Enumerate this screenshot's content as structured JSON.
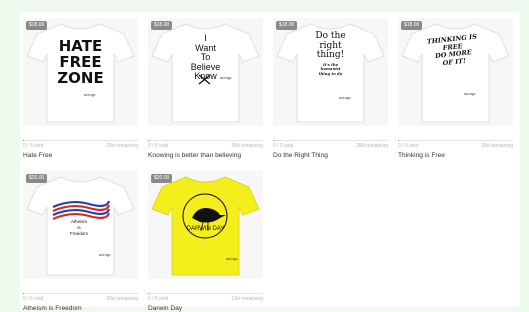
{
  "campaigns": [
    {
      "price": "$18.00",
      "shirt_color": "#ffffff",
      "sold": "0 / 5 sold",
      "remaining": "28d remaining",
      "title": "Hate Free",
      "design_text": {
        "line1": "HATE",
        "line2": "FREE",
        "line3": "ZONE"
      },
      "tag": "act.ngo"
    },
    {
      "price": "$18.00",
      "shirt_color": "#ffffff",
      "sold": "0 / 5 sold",
      "remaining": "28d remaining",
      "title": "Knowing is better than believing",
      "design_text": {
        "line1": "I",
        "line2": "Want",
        "line3": "To",
        "line4": "Believe",
        "line5": "Know"
      },
      "tag": "act.ngo"
    },
    {
      "price": "$18.00",
      "shirt_color": "#ffffff",
      "sold": "0 / 5 sold",
      "remaining": "28d remaining",
      "title": "Do the Right Thing",
      "design_text": {
        "line1": "Do the",
        "line2": "right",
        "line3": "thing!",
        "line4": "It's the",
        "line5": "humanist",
        "line6": "thing to do"
      },
      "tag": "act.ngo"
    },
    {
      "price": "$18.00",
      "shirt_color": "#ffffff",
      "sold": "0 / 5 sold",
      "remaining": "28d remaining",
      "title": "Thinking is Free",
      "design_text": {
        "line1": "THINKING IS",
        "line2": "FREE",
        "line3": "DO MORE",
        "line4": "OF IT!"
      },
      "tag": "act.ngo"
    },
    {
      "price": "$20.00",
      "shirt_color": "#ffffff",
      "sold": "0 / 5 sold",
      "remaining": "30d remaining",
      "title": "Atheism is Freedom",
      "design_text": {
        "line1": "Atheism",
        "line2": "is",
        "line3": "Freedom"
      },
      "tag": "act.ngo"
    },
    {
      "price": "$20.00",
      "shirt_color": "#f4ee1c",
      "sold": "0 / 5 sold",
      "remaining": "19d remaining",
      "title": "Darwin Day",
      "design_text": {
        "line1": "DARWIN DAY"
      },
      "tag": "act.ngo"
    }
  ]
}
